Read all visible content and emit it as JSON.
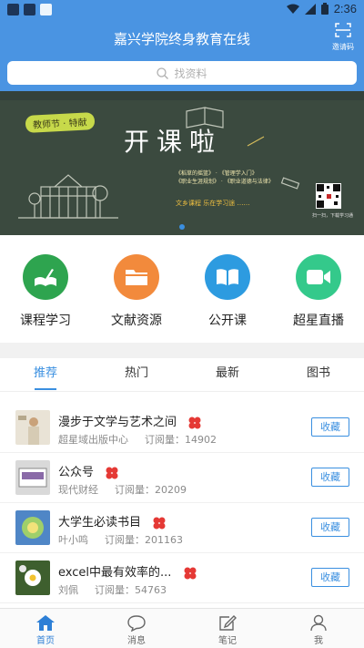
{
  "status_bar": {
    "time": "2:36"
  },
  "header": {
    "title": "嘉兴学院终身教育在线",
    "invite_label": "邀请码"
  },
  "search": {
    "placeholder": "找资料"
  },
  "banner": {
    "tag": "教师节 · 特献",
    "headline": "开课啦",
    "line1": "《稻草的摇篮》 · 《管理学入门》",
    "line2": "《职业生涯规划》 · 《职业道德与法律》",
    "slogan": "文乡课程 乐在学习途 ……",
    "qr_caption": "扫一扫，下载学习通"
  },
  "quick_entries": [
    {
      "label": "课程学习",
      "icon": "book-quill-icon",
      "color": "#2ea44f"
    },
    {
      "label": "文献资源",
      "icon": "folder-icon",
      "color": "#f28a3c"
    },
    {
      "label": "公开课",
      "icon": "open-book-icon",
      "color": "#2d9be0"
    },
    {
      "label": "超星直播",
      "icon": "video-camera-icon",
      "color": "#34c98b"
    }
  ],
  "tabs": [
    {
      "label": "推荐",
      "active": true
    },
    {
      "label": "热门",
      "active": false
    },
    {
      "label": "最新",
      "active": false
    },
    {
      "label": "图书",
      "active": false
    }
  ],
  "list": [
    {
      "title": "漫步于文学与艺术之间",
      "author": "超星域出版中心",
      "subscribers": "订阅量：14902",
      "button": "收藏"
    },
    {
      "title": "公众号",
      "author": "现代财经",
      "subscribers": "订阅量：20209",
      "button": "收藏"
    },
    {
      "title": "大学生必读书目",
      "author": "叶小鸣",
      "subscribers": "订阅量：201163",
      "button": "收藏"
    },
    {
      "title": "excel中最有效率的...",
      "author": "刘佩",
      "subscribers": "订阅量：54763",
      "button": "收藏"
    }
  ],
  "bottom_nav": [
    {
      "label": "首页",
      "icon": "home-icon",
      "active": true
    },
    {
      "label": "消息",
      "icon": "message-bubble-icon",
      "active": false
    },
    {
      "label": "笔记",
      "icon": "note-edit-icon",
      "active": false
    },
    {
      "label": "我",
      "icon": "person-icon",
      "active": false
    }
  ],
  "colors": {
    "primary": "#4a94e2",
    "accent": "#3a8fe0",
    "badge": "#e53935"
  }
}
